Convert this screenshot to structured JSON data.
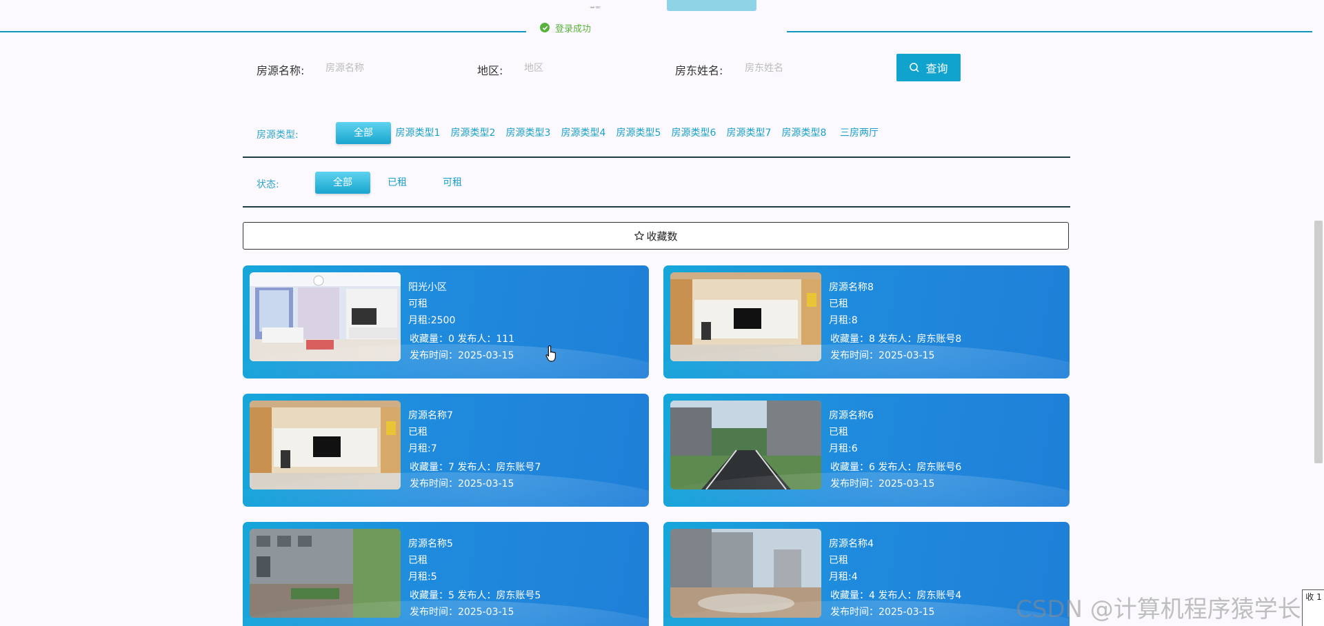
{
  "top_nav": {
    "peek_item": "首页"
  },
  "toast": {
    "message": "登录成功",
    "color": "#58b13d"
  },
  "search": {
    "name_label": "房源名称:",
    "name_placeholder": "房源名称",
    "area_label": "地区:",
    "area_placeholder": "地区",
    "landlord_label": "房东姓名:",
    "landlord_placeholder": "房东姓名",
    "query_label": "查询"
  },
  "filters": {
    "type_label": "房源类型:",
    "types": [
      "全部",
      "房源类型1",
      "房源类型2",
      "房源类型3",
      "房源类型4",
      "房源类型5",
      "房源类型6",
      "房源类型7",
      "房源类型8",
      "三房两厅"
    ],
    "status_label": "状态:",
    "statuses": [
      "全部",
      "已租",
      "可租"
    ],
    "active_color": "#18a5cf"
  },
  "sort": {
    "label": "收藏数"
  },
  "listings": [
    {
      "name": "阳光小区",
      "status": "可租",
      "rent": "月租:2500",
      "meta": "收藏量：0   发布人：111",
      "date": "发布时间：2025-03-15",
      "image": "living-room"
    },
    {
      "name": "房源名称8",
      "status": "已租",
      "rent": "月租:8",
      "meta": "收藏量：8   发布人：房东账号8",
      "date": "发布时间：2025-03-15",
      "image": "tv-wall"
    },
    {
      "name": "房源名称7",
      "status": "已租",
      "rent": "月租:7",
      "meta": "收藏量：7   发布人：房东账号7",
      "date": "发布时间：2025-03-15",
      "image": "tv-wall"
    },
    {
      "name": "房源名称6",
      "status": "已租",
      "rent": "月租:6",
      "meta": "收藏量：6   发布人：房东账号6",
      "date": "发布时间：2025-03-15",
      "image": "street"
    },
    {
      "name": "房源名称5",
      "status": "已租",
      "rent": "月租:5",
      "meta": "收藏量：5   发布人：房东账号5",
      "date": "发布时间：2025-03-15",
      "image": "building"
    },
    {
      "name": "房源名称4",
      "status": "已租",
      "rent": "月租:4",
      "meta": "收藏量：4   发布人：房东账号4",
      "date": "发布时间：2025-03-15",
      "image": "construction"
    }
  ],
  "watermark": "CSDN @计算机程序猿学长",
  "float_button": "收 1"
}
